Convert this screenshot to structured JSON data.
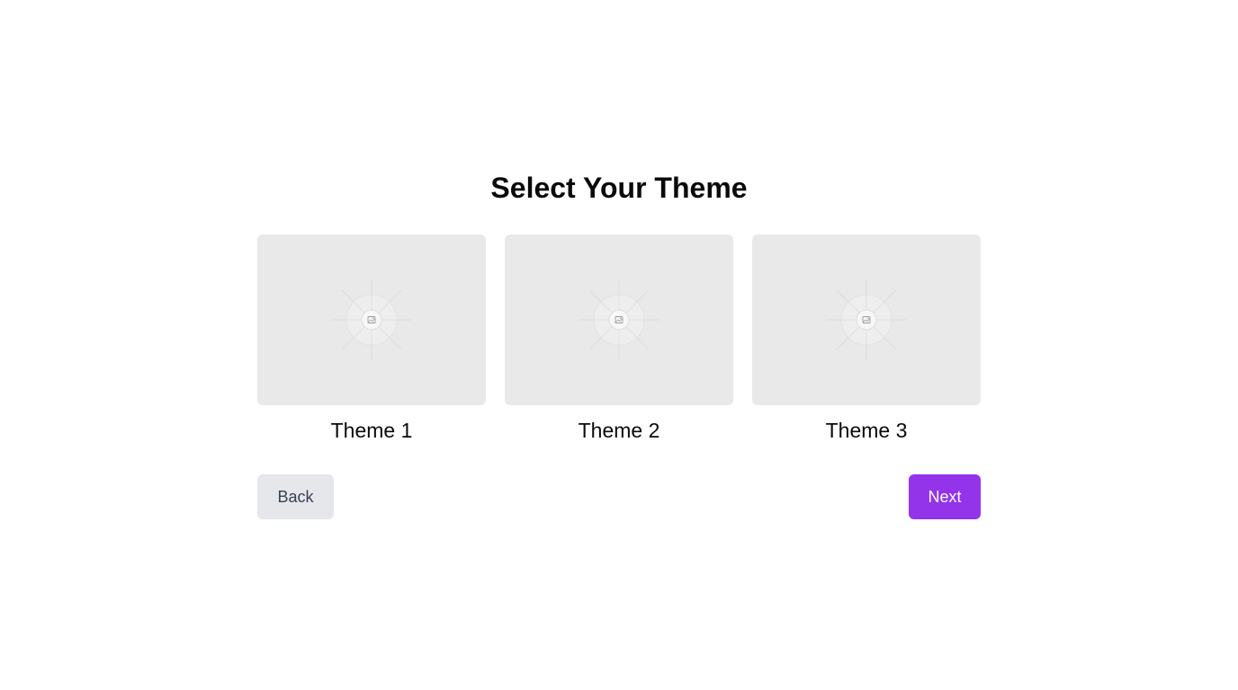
{
  "page": {
    "title": "Select Your Theme"
  },
  "themes": [
    {
      "label": "Theme 1"
    },
    {
      "label": "Theme 2"
    },
    {
      "label": "Theme 3"
    }
  ],
  "buttons": {
    "back_label": "Back",
    "next_label": "Next"
  },
  "colors": {
    "accent": "#9333ea",
    "secondary_button": "#e5e7eb",
    "preview_placeholder": "#e9e9e9"
  },
  "icons": {
    "preview": "image-placeholder-icon"
  }
}
